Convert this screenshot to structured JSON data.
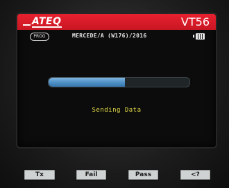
{
  "header": {
    "logo": "ATEQ",
    "model": "VT56"
  },
  "info": {
    "mode_badge": "PROG",
    "vehicle": "MERCEDE/A (W176)/2016",
    "battery_icon": "battery-icon"
  },
  "progress": {
    "fraction": 0.54,
    "color": "#4d8fc6"
  },
  "status": {
    "text": "Sending Data",
    "color": "#e9df4a"
  },
  "softkeys": [
    {
      "label": "Tx"
    },
    {
      "label": "Fail"
    },
    {
      "label": "Pass"
    },
    {
      "label": "<?"
    }
  ],
  "colors": {
    "header": "#d81b29",
    "screen": "#0b0c0b"
  }
}
